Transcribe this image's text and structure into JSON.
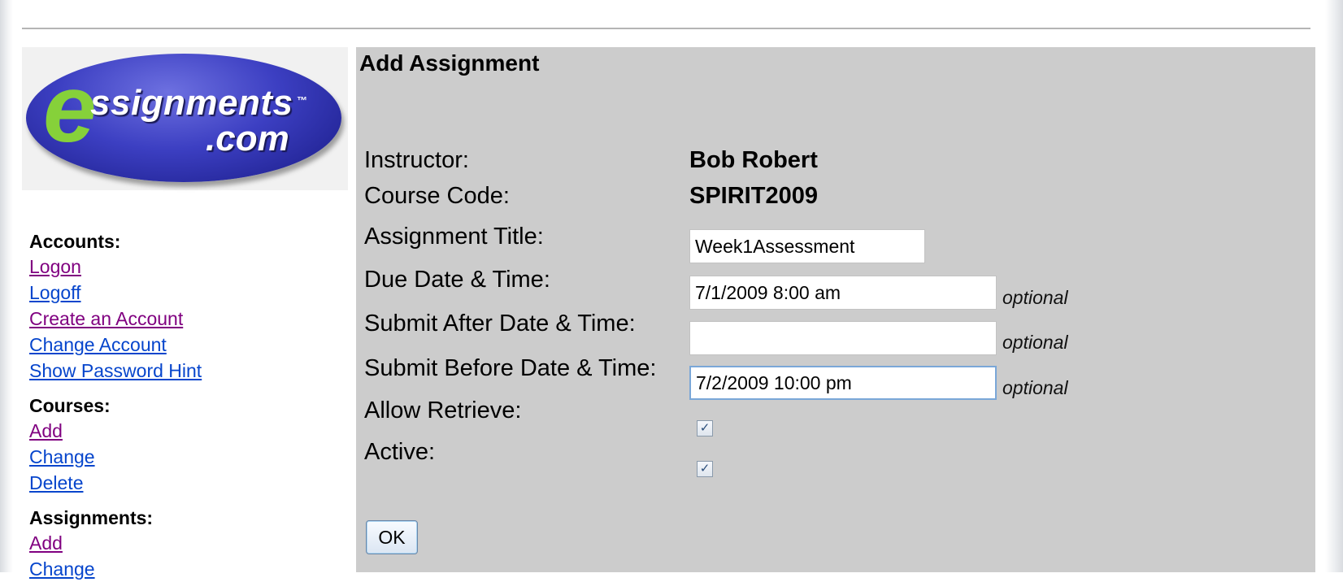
{
  "logo": {
    "letter": "e",
    "wordmark": "ssignments",
    "trademark": "™",
    "domain": ".com",
    "colors": {
      "oval": "#3c3fc2",
      "letter": "#86d13a",
      "text": "#ffffff"
    }
  },
  "nav": {
    "accounts": {
      "heading": "Accounts:",
      "links": [
        "Logon",
        "Logoff",
        "Create an Account",
        "Change Account",
        "Show Password Hint"
      ]
    },
    "courses": {
      "heading": "Courses:",
      "links": [
        "Add",
        "Change",
        "Delete"
      ]
    },
    "assignments": {
      "heading": "Assignments:",
      "links": [
        "Add",
        "Change"
      ]
    },
    "colors": {
      "visited": "#800080",
      "unvisited": "#0645cc"
    }
  },
  "form": {
    "title": "Add Assignment",
    "instructor": {
      "label": "Instructor:",
      "value": "Bob Robert"
    },
    "course_code": {
      "label": "Course Code:",
      "value": "SPIRIT2009"
    },
    "assignment_title": {
      "label": "Assignment Title:",
      "value": "Week1Assessment"
    },
    "due_date": {
      "label": "Due Date & Time:",
      "value": "7/1/2009 8:00 am",
      "note": "optional"
    },
    "submit_after": {
      "label": "Submit After Date & Time:",
      "value": "",
      "note": "optional"
    },
    "submit_before": {
      "label": "Submit Before Date & Time:",
      "value": "7/2/2009 10:00 pm",
      "note": "optional"
    },
    "allow_retrieve": {
      "label": "Allow Retrieve:",
      "checked": true
    },
    "active": {
      "label": "Active:",
      "checked": true
    },
    "ok_label": "OK",
    "panel_color": "#cccccc"
  }
}
